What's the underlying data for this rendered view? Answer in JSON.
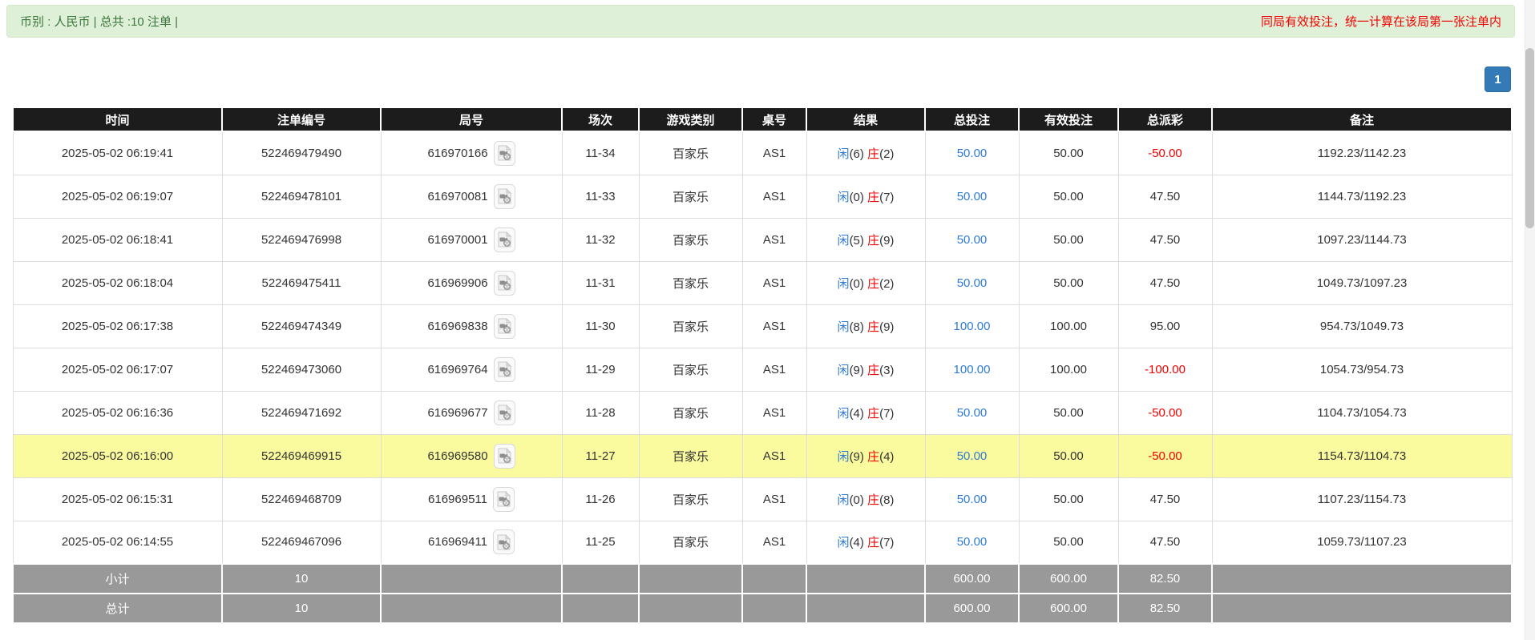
{
  "alert": {
    "left_text": "币别 : 人民币 | 总共 :10 注单 |",
    "right_text": "同局有效投注，统一计算在该局第一张注单内"
  },
  "pagination": {
    "current_page": "1"
  },
  "colors": {
    "alert_bg": "#dff0d8",
    "alert_border": "#d6e9c6",
    "alert_text": "#3c763d",
    "red": "#f00000",
    "link_blue": "#2e7bd8",
    "highlight_yellow": "#fafa9e",
    "header_black": "#1c1c1c",
    "summary_gray": "#999999",
    "button_blue": "#337ab7",
    "button_blue_border": "#2e6da4"
  },
  "table": {
    "headers": [
      "时间",
      "注单编号",
      "局号",
      "场次",
      "游戏类别",
      "桌号",
      "结果",
      "总投注",
      "有效投注",
      "总派彩",
      "备注"
    ],
    "video_icon_name": "video-replay-icon",
    "rows": [
      {
        "time": "2025-05-02 06:19:41",
        "bet_id": "522469479490",
        "round_id": "616970166",
        "session": "11-34",
        "game": "百家乐",
        "table_code": "AS1",
        "result": {
          "player_label": "闲",
          "player_value": "(6)",
          "banker_label": "庄",
          "banker_value": "(2)"
        },
        "total_bet": "50.00",
        "valid_bet": "50.00",
        "payout": "-50.00",
        "note": "1192.23/1142.23",
        "highlight": false
      },
      {
        "time": "2025-05-02 06:19:07",
        "bet_id": "522469478101",
        "round_id": "616970081",
        "session": "11-33",
        "game": "百家乐",
        "table_code": "AS1",
        "result": {
          "player_label": "闲",
          "player_value": "(0)",
          "banker_label": "庄",
          "banker_value": "(7)"
        },
        "total_bet": "50.00",
        "valid_bet": "50.00",
        "payout": "47.50",
        "note": "1144.73/1192.23",
        "highlight": false
      },
      {
        "time": "2025-05-02 06:18:41",
        "bet_id": "522469476998",
        "round_id": "616970001",
        "session": "11-32",
        "game": "百家乐",
        "table_code": "AS1",
        "result": {
          "player_label": "闲",
          "player_value": "(5)",
          "banker_label": "庄",
          "banker_value": "(9)"
        },
        "total_bet": "50.00",
        "valid_bet": "50.00",
        "payout": "47.50",
        "note": "1097.23/1144.73",
        "highlight": false
      },
      {
        "time": "2025-05-02 06:18:04",
        "bet_id": "522469475411",
        "round_id": "616969906",
        "session": "11-31",
        "game": "百家乐",
        "table_code": "AS1",
        "result": {
          "player_label": "闲",
          "player_value": "(0)",
          "banker_label": "庄",
          "banker_value": "(2)"
        },
        "total_bet": "50.00",
        "valid_bet": "50.00",
        "payout": "47.50",
        "note": "1049.73/1097.23",
        "highlight": false
      },
      {
        "time": "2025-05-02 06:17:38",
        "bet_id": "522469474349",
        "round_id": "616969838",
        "session": "11-30",
        "game": "百家乐",
        "table_code": "AS1",
        "result": {
          "player_label": "闲",
          "player_value": "(8)",
          "banker_label": "庄",
          "banker_value": "(9)"
        },
        "total_bet": "100.00",
        "valid_bet": "100.00",
        "payout": "95.00",
        "note": "954.73/1049.73",
        "highlight": false
      },
      {
        "time": "2025-05-02 06:17:07",
        "bet_id": "522469473060",
        "round_id": "616969764",
        "session": "11-29",
        "game": "百家乐",
        "table_code": "AS1",
        "result": {
          "player_label": "闲",
          "player_value": "(9)",
          "banker_label": "庄",
          "banker_value": "(3)"
        },
        "total_bet": "100.00",
        "valid_bet": "100.00",
        "payout": "-100.00",
        "note": "1054.73/954.73",
        "highlight": false
      },
      {
        "time": "2025-05-02 06:16:36",
        "bet_id": "522469471692",
        "round_id": "616969677",
        "session": "11-28",
        "game": "百家乐",
        "table_code": "AS1",
        "result": {
          "player_label": "闲",
          "player_value": "(4)",
          "banker_label": "庄",
          "banker_value": "(7)"
        },
        "total_bet": "50.00",
        "valid_bet": "50.00",
        "payout": "-50.00",
        "note": "1104.73/1054.73",
        "highlight": false
      },
      {
        "time": "2025-05-02 06:16:00",
        "bet_id": "522469469915",
        "round_id": "616969580",
        "session": "11-27",
        "game": "百家乐",
        "table_code": "AS1",
        "result": {
          "player_label": "闲",
          "player_value": "(9)",
          "banker_label": "庄",
          "banker_value": "(4)"
        },
        "total_bet": "50.00",
        "valid_bet": "50.00",
        "payout": "-50.00",
        "note": "1154.73/1104.73",
        "highlight": true
      },
      {
        "time": "2025-05-02 06:15:31",
        "bet_id": "522469468709",
        "round_id": "616969511",
        "session": "11-26",
        "game": "百家乐",
        "table_code": "AS1",
        "result": {
          "player_label": "闲",
          "player_value": "(0)",
          "banker_label": "庄",
          "banker_value": "(8)"
        },
        "total_bet": "50.00",
        "valid_bet": "50.00",
        "payout": "47.50",
        "note": "1107.23/1154.73",
        "highlight": false
      },
      {
        "time": "2025-05-02 06:14:55",
        "bet_id": "522469467096",
        "round_id": "616969411",
        "session": "11-25",
        "game": "百家乐",
        "table_code": "AS1",
        "result": {
          "player_label": "闲",
          "player_value": "(4)",
          "banker_label": "庄",
          "banker_value": "(7)"
        },
        "total_bet": "50.00",
        "valid_bet": "50.00",
        "payout": "47.50",
        "note": "1059.73/1107.23",
        "highlight": false
      }
    ],
    "subtotal": {
      "label": "小计",
      "count": "10",
      "total_bet": "600.00",
      "valid_bet": "600.00",
      "payout": "82.50"
    },
    "total": {
      "label": "总计",
      "count": "10",
      "total_bet": "600.00",
      "valid_bet": "600.00",
      "payout": "82.50"
    }
  }
}
